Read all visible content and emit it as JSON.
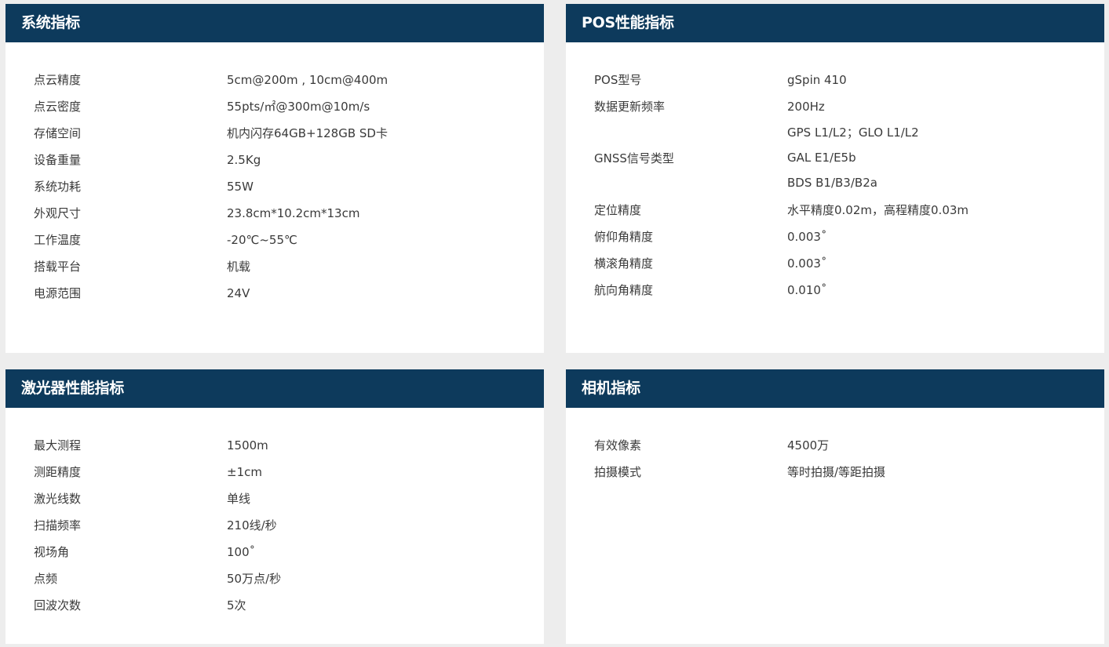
{
  "system": {
    "title": "系统指标",
    "rows": [
      {
        "label": "点云精度",
        "value": "5cm@200m , 10cm@400m"
      },
      {
        "label": "点云密度",
        "value": "55pts/㎡@300m@10m/s"
      },
      {
        "label": "存储空间",
        "value": "机内闪存64GB+128GB SD卡"
      },
      {
        "label": "设备重量",
        "value": "2.5Kg"
      },
      {
        "label": "系统功耗",
        "value": "55W"
      },
      {
        "label": "外观尺寸",
        "value": "23.8cm*10.2cm*13cm"
      },
      {
        "label": "工作温度",
        "value": "-20℃~55℃"
      },
      {
        "label": "搭载平台",
        "value": "机载"
      },
      {
        "label": "电源范围",
        "value": "24V"
      }
    ]
  },
  "pos": {
    "title": "POS性能指标",
    "rows": [
      {
        "label": "POS型号",
        "value": "gSpin 410"
      },
      {
        "label": "数据更新频率",
        "value": "200Hz"
      }
    ],
    "gnss": {
      "label": "GNSS信号类型",
      "lines": [
        "GPS L1/L2；GLO L1/L2",
        "GAL E1/E5b",
        "BDS B1/B3/B2a"
      ]
    },
    "rows2": [
      {
        "label": "定位精度",
        "value": "水平精度0.02m，高程精度0.03m"
      },
      {
        "label": "俯仰角精度",
        "value": "0.003˚"
      },
      {
        "label": "横滚角精度",
        "value": "0.003˚"
      },
      {
        "label": "航向角精度",
        "value": "0.010˚"
      }
    ]
  },
  "laser": {
    "title": "激光器性能指标",
    "rows": [
      {
        "label": "最大测程",
        "value": "1500m"
      },
      {
        "label": "测距精度",
        "value": "±1cm"
      },
      {
        "label": "激光线数",
        "value": "单线"
      },
      {
        "label": "扫描频率",
        "value": "210线/秒"
      },
      {
        "label": "视场角",
        "value": "100˚"
      },
      {
        "label": "点频",
        "value": "50万点/秒"
      },
      {
        "label": "回波次数",
        "value": "5次"
      }
    ]
  },
  "camera": {
    "title": "相机指标",
    "rows": [
      {
        "label": "有效像素",
        "value": "4500万"
      },
      {
        "label": "拍摄模式",
        "value": "等时拍摄/等距拍摄"
      }
    ]
  }
}
